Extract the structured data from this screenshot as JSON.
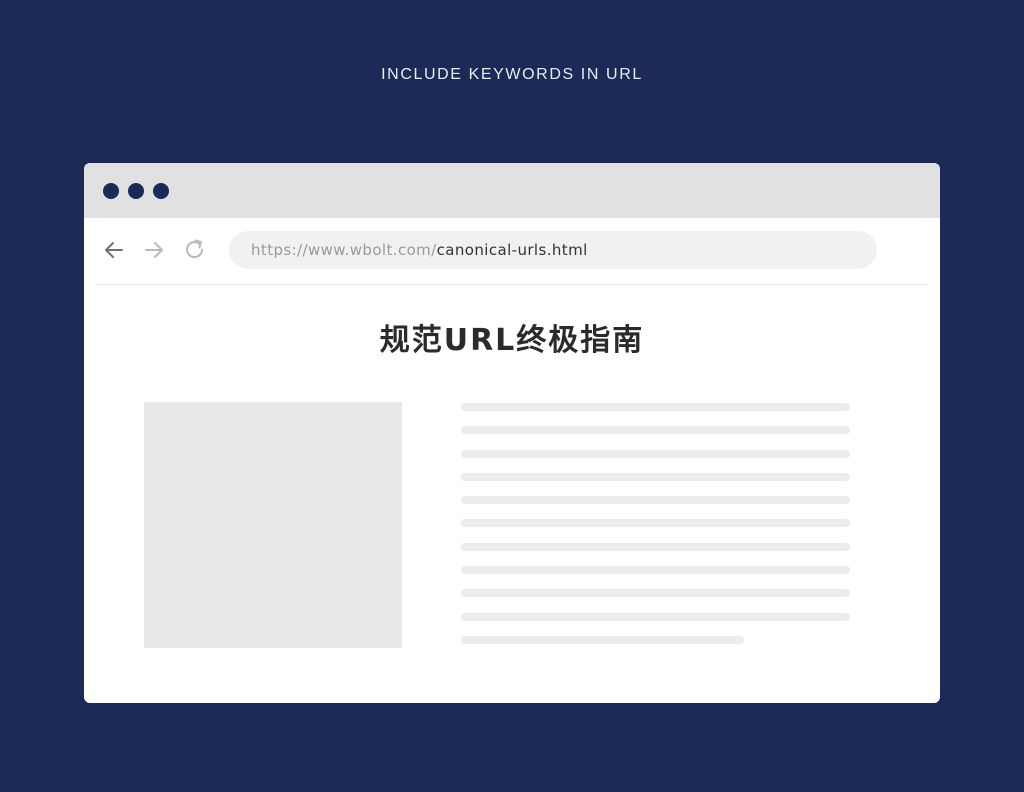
{
  "headline": "INCLUDE KEYWORDS IN URL",
  "colors": {
    "background": "#1b2a56",
    "window_dot": "#1b2a56",
    "titlebar": "#e1e1e2",
    "placeholder": "#e8e8e8"
  },
  "browser": {
    "window_dots": [
      "window-dot",
      "window-dot",
      "window-dot"
    ],
    "nav_icons": [
      "back-arrow-icon",
      "forward-arrow-icon",
      "reload-icon"
    ],
    "address": {
      "domain": "https://www.wbolt.com/",
      "path": "canonical-urls.html"
    }
  },
  "page": {
    "title": "规范URL终极指南",
    "text_line_count": 11
  }
}
